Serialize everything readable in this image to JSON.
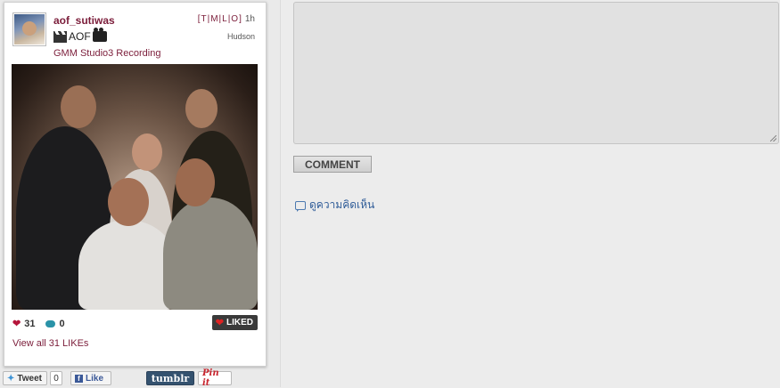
{
  "post": {
    "username": "aof_sutiwas",
    "shortcuts": "[T|M|L|O]",
    "age": "1h",
    "caption": "AOF",
    "filter": "Hudson",
    "location": "GMM Studio3 Recording",
    "likes": "31",
    "comments": "0",
    "liked_label": "LIKED",
    "view_all": "View all 31 LIKEs"
  },
  "share": {
    "tweet_label": "Tweet",
    "tweet_count": "0",
    "like_label": "Like",
    "tumblr_label": "tumblr",
    "pinit_label": "Pin it"
  },
  "comment_form": {
    "button_label": "COMMENT",
    "view_comments_label": "ดูความคิดเห็น"
  },
  "colors": {
    "accent": "#7b1d3a",
    "link": "#2f5c98",
    "heart": "#b5163b"
  }
}
